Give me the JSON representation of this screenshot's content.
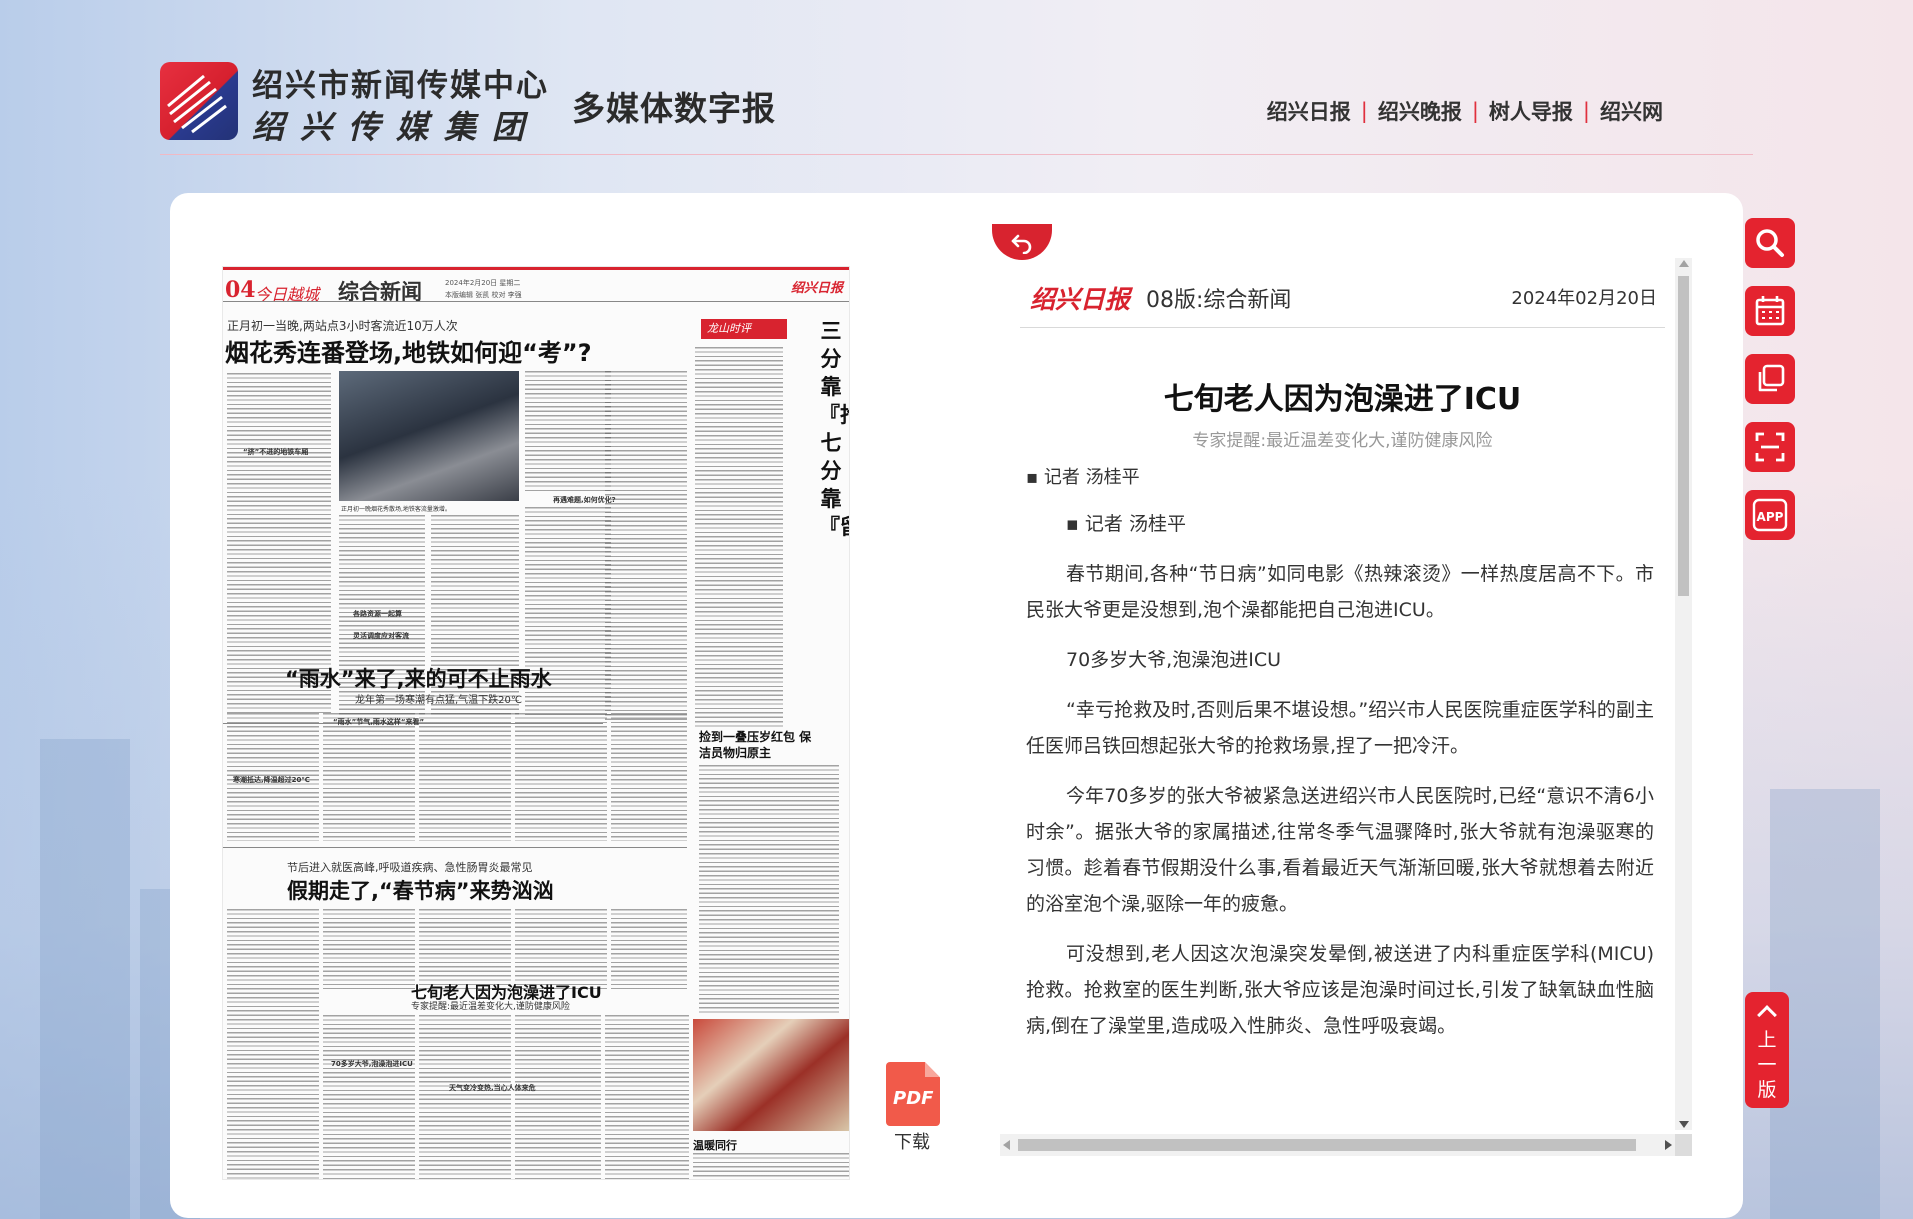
{
  "header": {
    "org_line1": "绍兴市新闻传媒中心",
    "org_line2": "绍兴传媒集团",
    "site_title": "多媒体数字报",
    "nav": [
      "绍兴日报",
      "绍兴晚报",
      "树人导报",
      "绍兴网"
    ]
  },
  "paper": {
    "page_no": "04",
    "brand": "今日越城",
    "section": "综合新闻",
    "date_line1": "2024年2月20日   星期二",
    "date_line2": "本版编辑  张凯    校对  李强",
    "masthead": "绍兴日报",
    "kicker1": "正月初一当晚,两站点3小时客流近10万人次",
    "headline1": "烟花秀连番登场,地铁如何迎“考”?",
    "photo1_caption": "正月初一晚烟花秀散场,地铁客流量激增。",
    "sub1a": "“挤”不进的地铁车厢",
    "sub1b": "各路资源一起算",
    "sub1c": "灵活调度应对客流",
    "sub1d": "再遇难题,如何优化?",
    "headline2": "“雨水”来了,来的可不止雨水",
    "sub2": "龙年第一场寒潮有点猛,气温下跌20℃",
    "sub2a": "“雨水”节气,雨水这样“来看”",
    "sub2b": "寒潮抵达,降温超过20℃",
    "kicker3": "节后进入就医高峰,呼吸道疾病、急性肠胃炎最常见",
    "headline3": "假期走了,“春节病”来势汹汹",
    "headline4": "七旬老人因为泡澡进了ICU",
    "sub4": "专家提醒:最近温差变化大,谨防健康风险",
    "sub4a": "70多岁大爷,泡澡泡进ICU",
    "sub4b": "天气变冷变热,当心人体来危",
    "right_tag": "龙山时评",
    "right_vertical": "三分靠『抢』,七分靠『留』",
    "right_head": "捡到一叠压岁红包 保洁员物归原主",
    "right_photo_caption": "温暖同行"
  },
  "pdf": {
    "icon_text": "PDF",
    "label": "下载"
  },
  "article": {
    "brand": "绍兴日报",
    "edition": "08版:综合新闻",
    "date": "2024年02月20日",
    "title": "七旬老人因为泡澡进了ICU",
    "subtitle": "专家提醒:最近温差变化大,谨防健康风险",
    "author_top": "▪ 记者 汤桂平",
    "paragraphs": [
      "▪ 记者 汤桂平",
      "春节期间,各种“节日病”如同电影《热辣滚烫》一样热度居高不下。市民张大爷更是没想到,泡个澡都能把自己泡进ICU。",
      "70多岁大爷,泡澡泡进ICU",
      "“幸亏抢救及时,否则后果不堪设想。”绍兴市人民医院重症医学科的副主任医师吕铁回想起张大爷的抢救场景,捏了一把冷汗。",
      "今年70多岁的张大爷被紧急送进绍兴市人民医院时,已经“意识不清6小时余”。据张大爷的家属描述,往常冬季气温骤降时,张大爷就有泡澡驱寒的习惯。趁着春节假期没什么事,看着最近天气渐渐回暖,张大爷就想着去附近的浴室泡个澡,驱除一年的疲惫。",
      "可没想到,老人因这次泡澡突发晕倒,被送进了内科重症医学科(MICU)抢救。抢救室的医生判断,张大爷应该是泡澡时间过长,引发了缺氧缺血性脑病,倒在了澡堂里,造成吸入性肺炎、急性呼吸衰竭。"
    ]
  },
  "tools": {
    "items": [
      "search-icon",
      "calendar-icon",
      "copy-icon",
      "scan-icon",
      "app-icon"
    ],
    "app_text": "APP",
    "prev_page": "上一版"
  },
  "colors": {
    "accent": "#e4232f",
    "brand_red": "#d8232f",
    "nav_separator": "#e0303e"
  }
}
